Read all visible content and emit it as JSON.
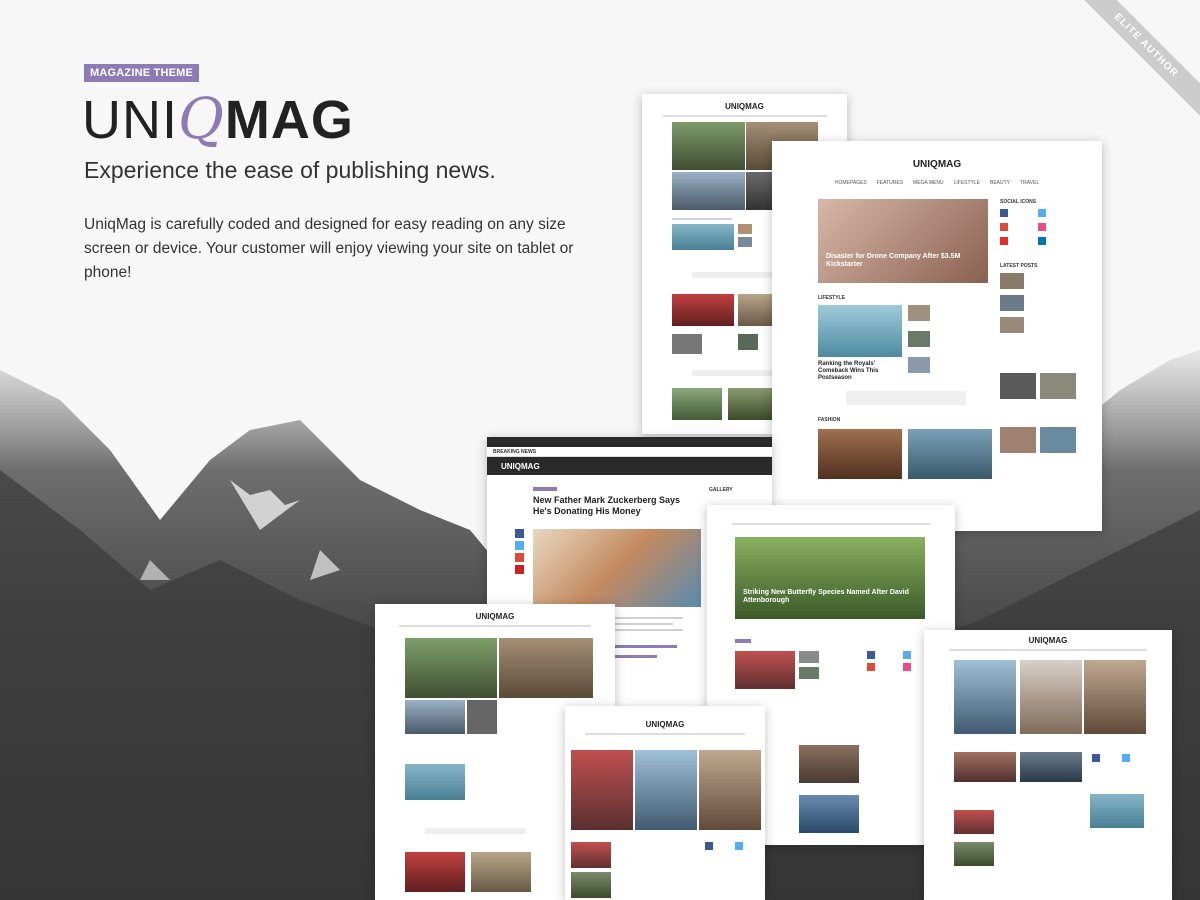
{
  "badge": "MAGAZINE THEME",
  "logo": {
    "part1": "UNI",
    "part2": "Q",
    "part3": "MAG"
  },
  "tagline": "Experience the ease of publishing news.",
  "description": "UniqMag is carefully coded and designed for easy reading on any size screen or device. Your customer will enjoy viewing your site on tablet or phone!",
  "ribbon": "ELITE AUTHOR",
  "previews": {
    "mock_logo": "UNIQMAG",
    "drone_headline": "Disaster for Drone Company After $3.5M Kickstarter",
    "lifestyle_label": "LIFESTYLE",
    "royals_headline": "Ranking the Royals' Comeback Wins This Postseason",
    "fashion_label": "FASHION",
    "social_icons_label": "SOCIAL ICONS",
    "latest_posts_label": "LATEST POSTS",
    "breaking_news_label": "BREAKING NEWS",
    "zuckerberg_headline": "New Father Mark Zuckerberg Says He's Donating His Money",
    "butterfly_headline": "Striking New Butterfly Species Named After David Attenborough",
    "gallery_label": "GALLERY",
    "nav_items": [
      "HOMEPAGES",
      "FEATURES",
      "MEGA MENU",
      "LIFESTYLE",
      "BEAUTY",
      "TRAVEL"
    ]
  },
  "colors": {
    "accent": "#8e7ab5"
  }
}
